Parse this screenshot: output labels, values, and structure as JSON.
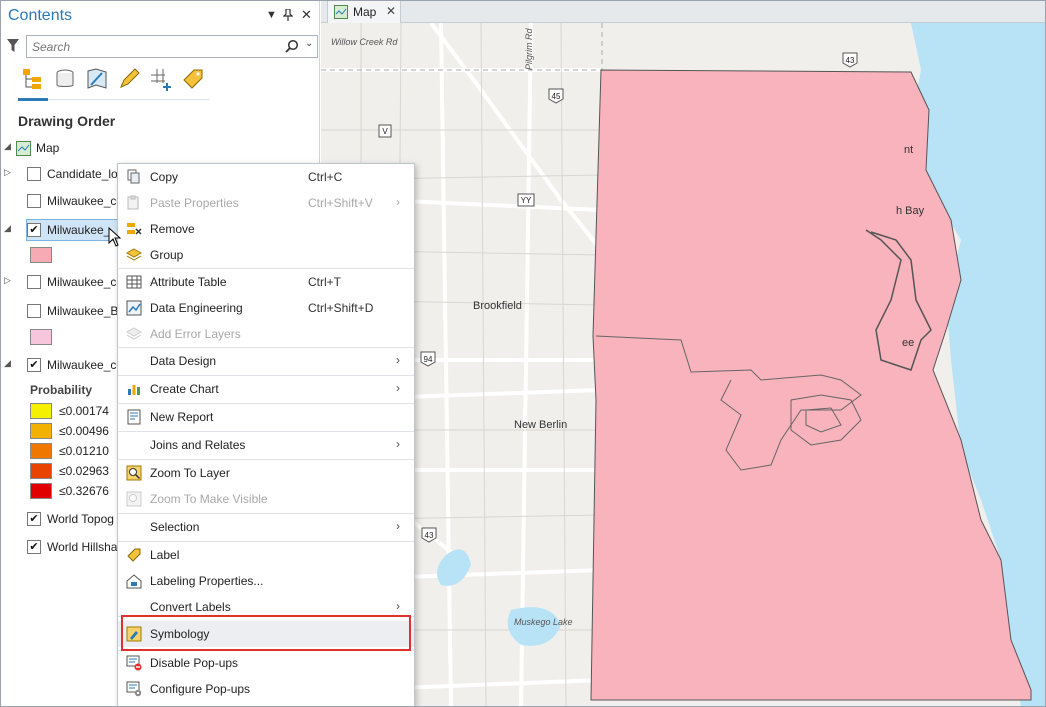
{
  "contents": {
    "title": "Contents",
    "search_placeholder": "Search",
    "section_title": "Drawing Order",
    "map_label": "Map",
    "layers": [
      {
        "label": "Candidate_lo",
        "checked": false,
        "expanded": false
      },
      {
        "label": "Milwaukee_co",
        "checked": false,
        "expanded": false
      },
      {
        "label": "Milwaukee_",
        "checked": true,
        "expanded": true,
        "selected": true,
        "swatch": "#f6aab4"
      },
      {
        "label": "Milwaukee_co",
        "checked": false,
        "expanded": false
      },
      {
        "label": "Milwaukee_B",
        "checked": false,
        "expanded": true,
        "swatch": "#f8c6dc"
      },
      {
        "label": "Milwaukee_co",
        "checked": true,
        "expanded": true
      },
      {
        "label": "World Topog",
        "checked": true
      },
      {
        "label": "World Hillsha",
        "checked": true
      }
    ],
    "legend_title": "Probability",
    "legend": [
      {
        "label": "≤0.00174",
        "color": "#f4f000"
      },
      {
        "label": "≤0.00496",
        "color": "#f2b100"
      },
      {
        "label": "≤0.01210",
        "color": "#ef7700"
      },
      {
        "label": "≤0.02963",
        "color": "#e84400"
      },
      {
        "label": "≤0.32676",
        "color": "#e00000"
      }
    ]
  },
  "map_tab": {
    "label": "Map",
    "close": "✕"
  },
  "map": {
    "places": [
      "Brookfield",
      "New Berlin",
      "Muskego Lake"
    ],
    "roads": [
      "Willow Creek Rd",
      "Pilgrim Rd"
    ],
    "shields": [
      "43",
      "45",
      "V",
      "YY",
      "94",
      "43"
    ],
    "partial_labels": [
      "nt",
      "h Bay",
      "ee"
    ],
    "county_fill": "#f8b3bc"
  },
  "context_menu": {
    "items": [
      {
        "label": "Copy",
        "shortcut": "Ctrl+C",
        "icon": "copy-icon"
      },
      {
        "label": "Paste Properties",
        "shortcut": "Ctrl+Shift+V",
        "icon": "paste-icon",
        "disabled": true,
        "submenu": true
      },
      {
        "label": "Remove",
        "icon": "remove-layer-icon"
      },
      {
        "label": "Group",
        "icon": "group-layers-icon"
      },
      {
        "label": "Attribute Table",
        "shortcut": "Ctrl+T",
        "icon": "table-icon"
      },
      {
        "label": "Data Engineering",
        "shortcut": "Ctrl+Shift+D",
        "icon": "data-engineering-icon"
      },
      {
        "label": "Add Error Layers",
        "icon": "error-layers-icon",
        "disabled": true
      },
      {
        "label": "Data Design",
        "submenu": true
      },
      {
        "label": "Create Chart",
        "icon": "chart-icon",
        "submenu": true
      },
      {
        "label": "New Report",
        "icon": "report-icon"
      },
      {
        "label": "Joins and Relates",
        "submenu": true
      },
      {
        "label": "Zoom To Layer",
        "icon": "zoom-layer-icon"
      },
      {
        "label": "Zoom To Make Visible",
        "icon": "zoom-visible-icon",
        "disabled": true
      },
      {
        "label": "Selection",
        "submenu": true
      },
      {
        "label": "Label",
        "icon": "label-icon"
      },
      {
        "label": "Labeling Properties...",
        "icon": "labeling-properties-icon"
      },
      {
        "label": "Convert Labels",
        "submenu": true
      },
      {
        "label": "Symbology",
        "icon": "symbology-icon",
        "highlighted": true
      },
      {
        "label": "Disable Pop-ups",
        "icon": "disable-popups-icon"
      },
      {
        "label": "Configure Pop-ups",
        "icon": "configure-popups-icon"
      }
    ]
  },
  "colors": {
    "accent": "#2a7ab8",
    "highlight_box": "#e03030",
    "water": "#b8e3f7"
  }
}
